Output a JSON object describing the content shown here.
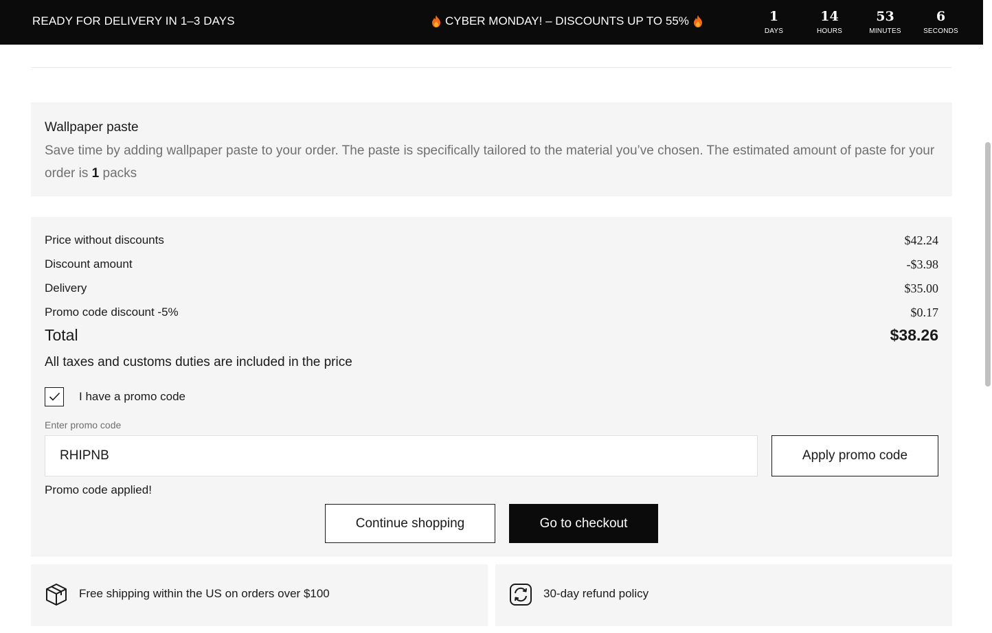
{
  "topbar": {
    "delivery_text": "READY FOR DELIVERY IN 1–3 DAYS",
    "promo_text": "CYBER MONDAY! – DISCOUNTS UP TO 55%",
    "countdown": [
      {
        "value": "1",
        "label": "DAYS"
      },
      {
        "value": "14",
        "label": "HOURS"
      },
      {
        "value": "53",
        "label": "MINUTES"
      },
      {
        "value": "6",
        "label": "SECONDS"
      }
    ]
  },
  "paste": {
    "title": "Wallpaper paste",
    "description": "Save time by adding wallpaper paste to your order. The paste is specifically tailored to the material you’ve chosen. The estimated amount of paste for your order is",
    "amount": "1",
    "unit": "packs"
  },
  "summary": {
    "price_without_discounts_label": "Price without discounts",
    "price_without_discounts_value": "$42.24",
    "discount_amount_label": "Discount amount",
    "discount_amount_value": "-$3.98",
    "delivery_label": "Delivery",
    "delivery_value": "$35.00",
    "promo_discount_label": "Promo code discount -5%",
    "promo_discount_value": "$0.17",
    "total_label": "Total",
    "total_value": "$38.26",
    "taxes_note": "All taxes and customs duties are included in the price"
  },
  "promo": {
    "checkbox_label": "I have a promo code",
    "checked": true,
    "input_label": "Enter promo code",
    "input_value": "RHIPNB",
    "apply_label": "Apply promo code",
    "status": "Promo code applied!"
  },
  "actions": {
    "continue_label": "Continue shopping",
    "checkout_label": "Go to checkout"
  },
  "features": [
    {
      "icon": "box-icon",
      "text": "Free shipping within the US on orders over $100"
    },
    {
      "icon": "refund-icon",
      "text": "30-day refund policy"
    }
  ],
  "colors": {
    "topbar_bg": "#0b0b0b",
    "panel_bg": "#f5f5f5",
    "flame": "#f26a1b"
  }
}
